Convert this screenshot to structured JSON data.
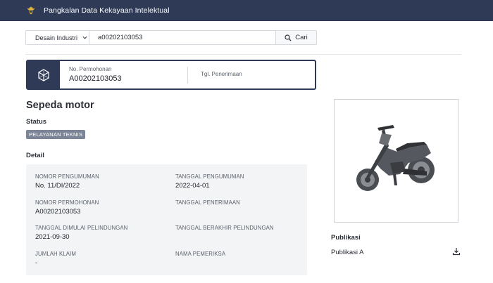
{
  "header": {
    "title": "Pangkalan Data Kekayaan Intelektual",
    "logo_icon": "garuda-emblem-icon"
  },
  "search": {
    "type_selected": "Desain Industri",
    "query_value": "a00202103053",
    "button_label": "Cari"
  },
  "application": {
    "number_label": "No. Permohonan",
    "number_value": "A00202103053",
    "received_label": "Tgl. Penerimaan",
    "icon": "cube-icon"
  },
  "title": "Sepeda motor",
  "status": {
    "label": "Status",
    "badge": "PELAYANAN TEKNIS"
  },
  "detail": {
    "label": "Detail",
    "fields": [
      {
        "key": "NOMOR PENGUMUMAN",
        "value": "No. 11/DI/2022"
      },
      {
        "key": "TANGGAL PENGUMUMAN",
        "value": "2022-04-01"
      },
      {
        "key": "NOMOR PERMOHONAN",
        "value": "A00202103053"
      },
      {
        "key": "TANGGAL PENERIMAAN",
        "value": ""
      },
      {
        "key": "TANGGAL DIMULAI PELINDUNGAN",
        "value": "2021-09-30"
      },
      {
        "key": "TANGGAL BERAKHIR PELINDUNGAN",
        "value": ""
      },
      {
        "key": "JUMLAH KLAIM",
        "value": "-"
      },
      {
        "key": "NAMA PEMERIKSA",
        "value": ""
      }
    ]
  },
  "publication": {
    "title": "Publikasi",
    "item": "Publikasi A",
    "download_icon": "download-icon"
  },
  "colors": {
    "navy": "#2e3a56",
    "badge": "#7b8597",
    "panel": "#f3f4f6"
  }
}
